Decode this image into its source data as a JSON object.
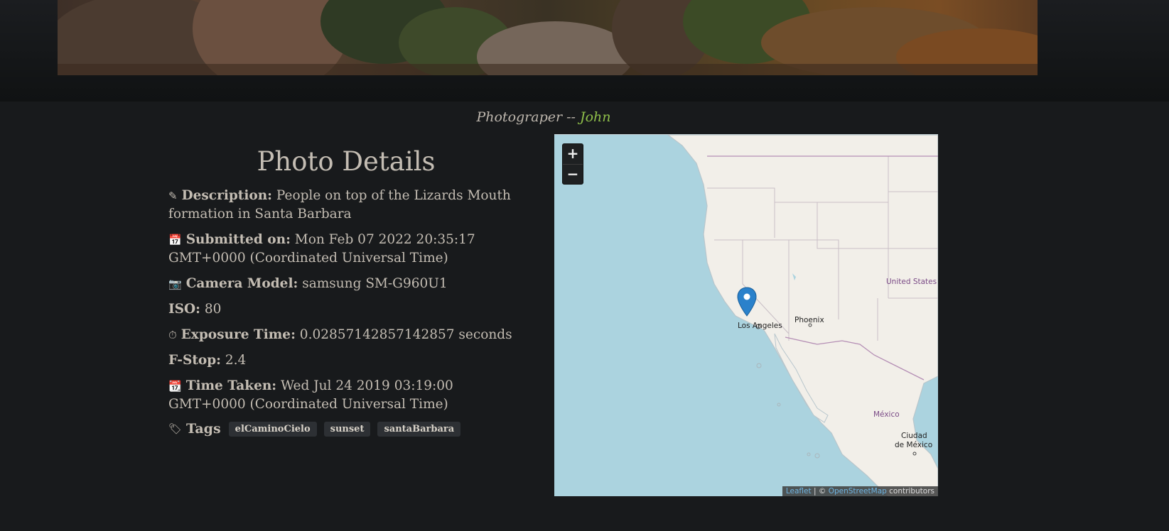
{
  "photographer": {
    "prefix": "Photograper -- ",
    "name": "John"
  },
  "details": {
    "title": "Photo Details",
    "description": {
      "icon": "pencil-icon",
      "label": "Description:",
      "value": "People on top of the Lizards Mouth formation in Santa Barbara"
    },
    "submitted": {
      "icon": "calendar-icon",
      "label": "Submitted on:",
      "value": "Mon Feb 07 2022 20:35:17 GMT+0000 (Coordinated Universal Time)"
    },
    "camera": {
      "icon": "camera-icon",
      "label": "Camera Model:",
      "value": "samsung SM-G960U1"
    },
    "iso": {
      "label": "ISO:",
      "value": "80"
    },
    "exposure": {
      "icon": "stopwatch-icon",
      "label": "Exposure Time:",
      "value": "0.02857142857142857 seconds"
    },
    "fstop": {
      "label": "F-Stop:",
      "value": "2.4"
    },
    "taken": {
      "icon": "calendar-icon",
      "label": "Time Taken:",
      "value": "Wed Jul 24 2019 03:19:00 GMT+0000 (Coordinated Universal Time)"
    },
    "tags": {
      "icon": "tag-icon",
      "label": "Tags",
      "items": [
        "elCaminoCielo",
        "sunset",
        "santaBarbara"
      ]
    }
  },
  "map": {
    "zoom_in": "+",
    "zoom_out": "−",
    "labels": {
      "united_states": "United States",
      "los_angeles": "Los Angeles",
      "phoenix": "Phoenix",
      "mexico": "México",
      "ciudad_de_mexico_1": "Ciudad",
      "ciudad_de_mexico_2": "de México"
    },
    "attribution": {
      "leaflet": "Leaflet",
      "sep": " | © ",
      "osm": "OpenStreetMap",
      "suffix": " contributors"
    },
    "colors": {
      "water": "#abd3df",
      "land": "#f2efe9",
      "marker": "#2a81cb"
    }
  }
}
